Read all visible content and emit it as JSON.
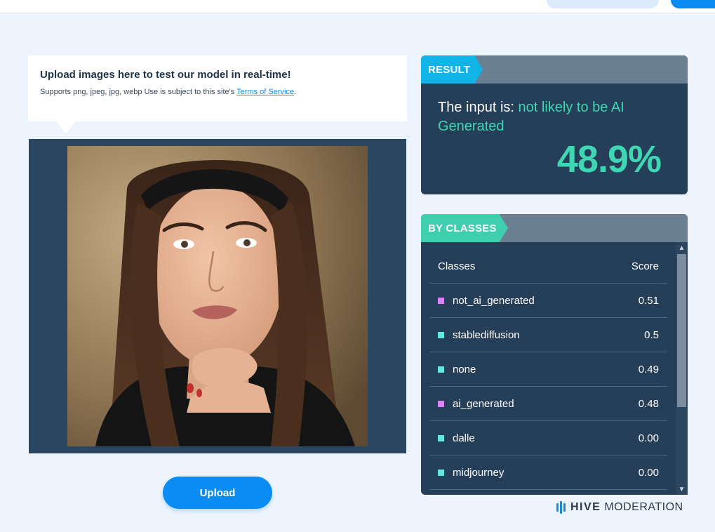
{
  "upload": {
    "title": "Upload images here to test our model in real-time!",
    "subtitle": "Supports png, jpeg, jpg, webp Use is subject to this site's",
    "tos_link": "Terms of Service",
    "tos_suffix": ".",
    "button_label": "Upload"
  },
  "result": {
    "tag": "RESULT",
    "prefix": "The input is: ",
    "verdict": "not likely to be AI Generated",
    "percent": "48.9%"
  },
  "classes": {
    "tag": "BY CLASSES",
    "header_class": "Classes",
    "header_score": "Score",
    "rows": [
      {
        "name": "not_ai_generated",
        "score": "0.51",
        "color": "#dc84f5"
      },
      {
        "name": "stablediffusion",
        "score": "0.5",
        "color": "#62e8de"
      },
      {
        "name": "none",
        "score": "0.49",
        "color": "#62e8de"
      },
      {
        "name": "ai_generated",
        "score": "0.48",
        "color": "#dc84f5"
      },
      {
        "name": "dalle",
        "score": "0.00",
        "color": "#62e8de"
      },
      {
        "name": "midjourney",
        "score": "0.00",
        "color": "#62e8de"
      }
    ]
  },
  "logo": {
    "hive": "HIVE",
    "moderation": "MODERATION"
  },
  "colors": {
    "accent_blue": "#0a8cf2",
    "panel_dark": "#263f58",
    "result_green": "#3ed6b3",
    "tag_result": "#12b4e8",
    "tag_classes": "#3ecfae"
  }
}
